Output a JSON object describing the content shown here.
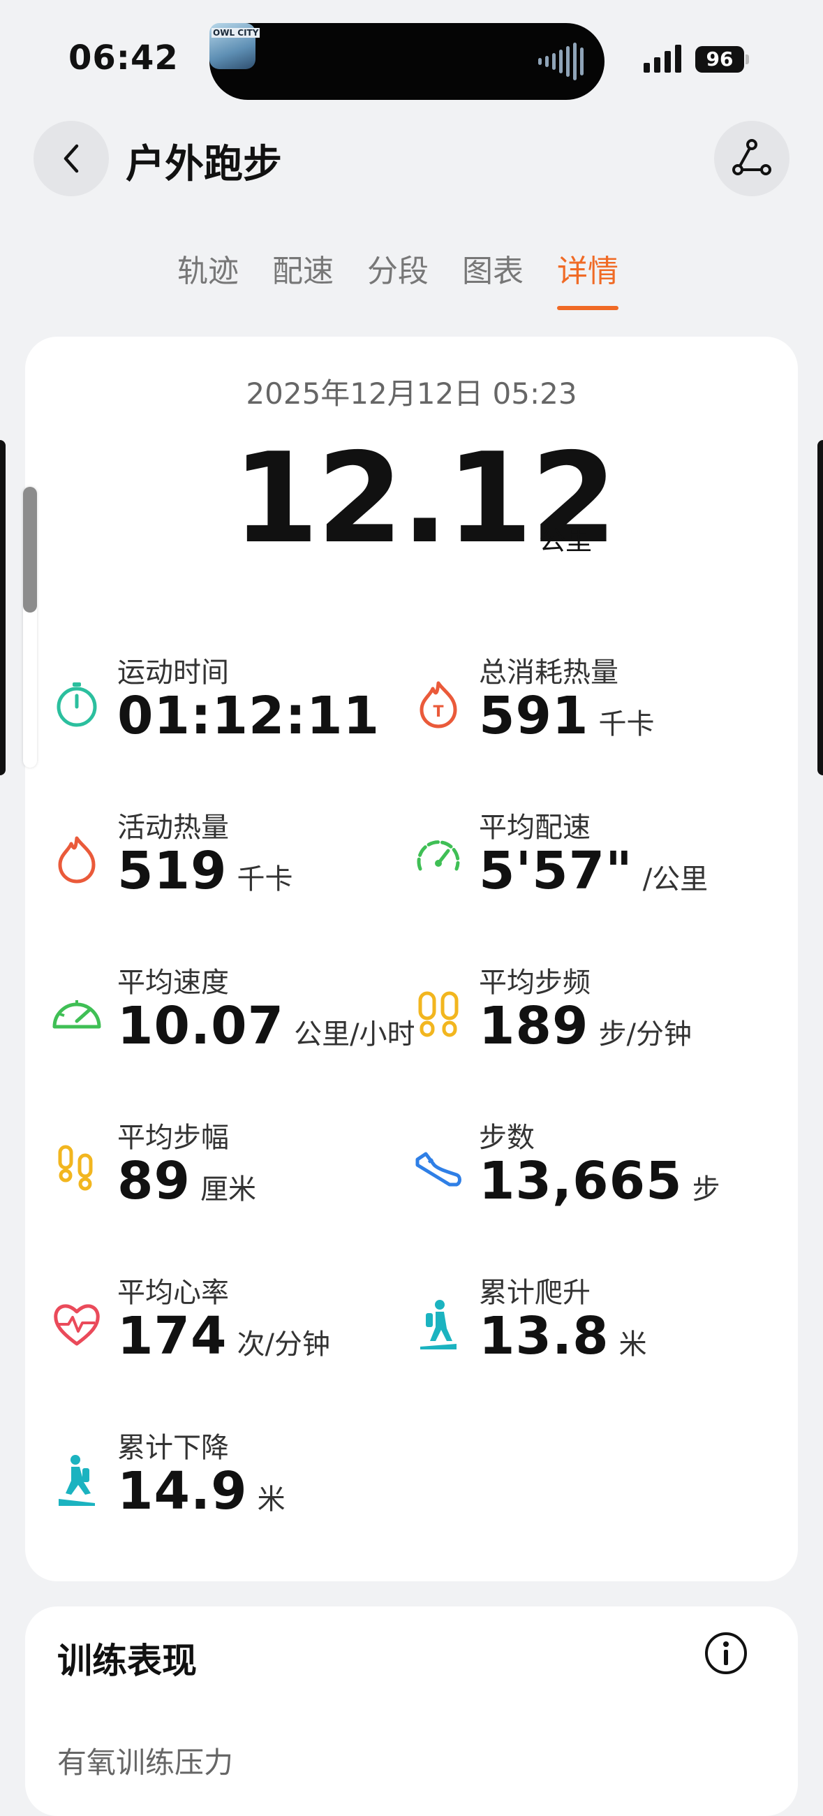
{
  "status_bar": {
    "time": "06:42",
    "album_text": "OWL CITY",
    "battery": "96"
  },
  "header": {
    "title": "户外跑步",
    "back_icon": "chevron-left-icon",
    "route_icon": "route-share-icon"
  },
  "tabs": [
    {
      "label": "轨迹"
    },
    {
      "label": "配速"
    },
    {
      "label": "分段"
    },
    {
      "label": "图表"
    },
    {
      "label": "详情",
      "active": true
    }
  ],
  "summary": {
    "datetime": "2025年12月12日 05:23",
    "distance": "12.12",
    "distance_unit": "公里"
  },
  "metrics": [
    {
      "label": "运动时间",
      "value": "01:12:11",
      "unit": "",
      "icon": "stopwatch-icon",
      "color": "#2bbf9e"
    },
    {
      "label": "总消耗热量",
      "value": "591",
      "unit": "千卡",
      "icon": "total-calorie-flame-icon",
      "color": "#ea5a3a"
    },
    {
      "label": "活动热量",
      "value": "519",
      "unit": "千卡",
      "icon": "flame-icon",
      "color": "#ea5a3a"
    },
    {
      "label": "平均配速",
      "value": "5'57\"",
      "unit": "/公里",
      "icon": "pace-gauge-icon",
      "color": "#3fbf55"
    },
    {
      "label": "平均速度",
      "value": "10.07",
      "unit": "公里/小时",
      "icon": "speedometer-icon",
      "color": "#3fbf55"
    },
    {
      "label": "平均步频",
      "value": "189",
      "unit": "步/分钟",
      "icon": "footprints-icon",
      "color": "#f2b61f"
    },
    {
      "label": "平均步幅",
      "value": "89",
      "unit": "厘米",
      "icon": "footprints-small-icon",
      "color": "#f2b61f"
    },
    {
      "label": "步数",
      "value": "13,665",
      "unit": "步",
      "icon": "sneaker-icon",
      "color": "#2f7fe6"
    },
    {
      "label": "平均心率",
      "value": "174",
      "unit": "次/分钟",
      "icon": "heartbeat-icon",
      "color": "#ea4a5a"
    },
    {
      "label": "累计爬升",
      "value": "13.8",
      "unit": "米",
      "icon": "hiker-uphill-icon",
      "color": "#1bb3c0"
    },
    {
      "label": "累计下降",
      "value": "14.9",
      "unit": "米",
      "icon": "hiker-downhill-icon",
      "color": "#1bb3c0"
    }
  ],
  "training": {
    "title": "训练表现",
    "subtitle": "有氧训练压力",
    "info_icon": "info-icon"
  },
  "colors": {
    "accent": "#f06a25",
    "background": "#f1f2f4"
  }
}
